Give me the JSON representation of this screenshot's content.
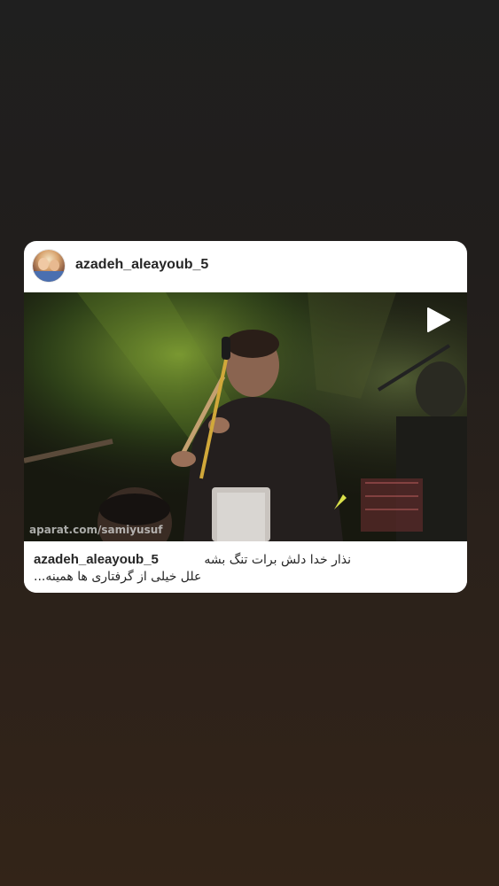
{
  "post": {
    "username": "azadeh_aleayoub_5",
    "avatar_icon": "profile-photo-icon",
    "play_icon": "play-icon",
    "watermark": "aparat.com/samiyusuf",
    "caption_username": "azadeh_aleayoub_5",
    "caption_line1": "نذار خدا دلش برات تنگ بشه",
    "caption_line2": "علل خیلی از گرفتاری ها همینه..."
  }
}
